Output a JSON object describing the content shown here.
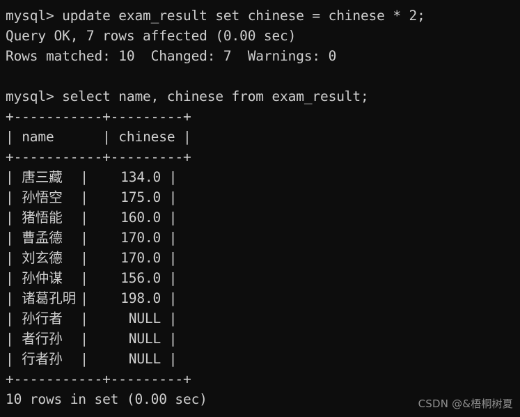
{
  "terminal": {
    "prompt": "mysql>",
    "background_color": "#0d0d0d",
    "text_color": "#cfcfcf",
    "watermark": "CSDN @&梧桐树夏"
  },
  "session": {
    "blocks": [
      {
        "command_line": "mysql> update exam_result set chinese = chinese * 2;",
        "status_lines": [
          "Query OK, 7 rows affected (0.00 sec)",
          "Rows matched: 10  Changed: 7  Warnings: 0"
        ]
      },
      {
        "command_line": "mysql> select name, chinese from exam_result;",
        "footer": "10 rows in set (0.00 sec)"
      }
    ]
  },
  "result_table": {
    "rule_top": "+-----------+---------+",
    "rule_mid": "+-----------+---------+",
    "rule_bottom": "+-----------+---------+",
    "header_prefix": "| ",
    "header_name": "name",
    "header_name_pad": "      | ",
    "header_chinese": "chinese",
    "header_suffix": " |",
    "columns": [
      "name",
      "chinese"
    ],
    "rows": [
      {
        "name": "唐三藏",
        "chinese": "134.0",
        "chinese_cell": "   134.0 |"
      },
      {
        "name": "孙悟空",
        "chinese": "175.0",
        "chinese_cell": "   175.0 |"
      },
      {
        "name": "猪悟能",
        "chinese": "160.0",
        "chinese_cell": "   160.0 |"
      },
      {
        "name": "曹孟德",
        "chinese": "170.0",
        "chinese_cell": "   170.0 |"
      },
      {
        "name": "刘玄德",
        "chinese": "170.0",
        "chinese_cell": "   170.0 |"
      },
      {
        "name": "孙仲谋",
        "chinese": "156.0",
        "chinese_cell": "   156.0 |"
      },
      {
        "name": "诸葛孔明",
        "chinese": "198.0",
        "chinese_cell": "   198.0 |"
      },
      {
        "name": "孙行者",
        "chinese": "NULL",
        "chinese_cell": "    NULL |"
      },
      {
        "name": "者行孙",
        "chinese": "NULL",
        "chinese_cell": "    NULL |"
      },
      {
        "name": "行者孙",
        "chinese": "NULL",
        "chinese_cell": "    NULL |"
      }
    ],
    "row_prefix": "| ",
    "row_mid": "| "
  }
}
